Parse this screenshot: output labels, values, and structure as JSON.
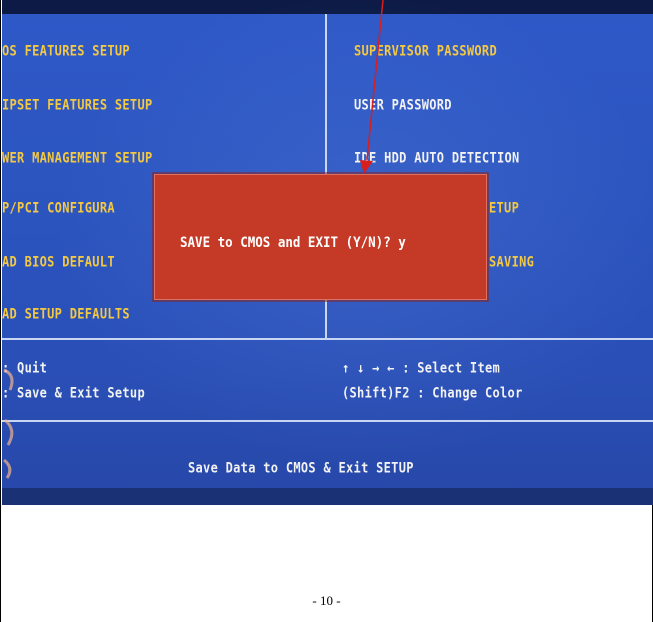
{
  "bios": {
    "left_menu": [
      "OS FEATURES SETUP",
      "IPSET FEATURES SETUP",
      "WER MANAGEMENT SETUP",
      "P/PCI CONFIGURA",
      "AD BIOS DEFAULT",
      "AD SETUP DEFAULTS"
    ],
    "right_menu": [
      "SUPERVISOR PASSWORD",
      "USER PASSWORD",
      "IDE HDD AUTO DETECTION",
      "ETUP",
      "SAVING"
    ],
    "dialog_prompt": "SAVE to CMOS and EXIT (Y/N)? y",
    "help_left": [
      ": Quit",
      ": Save & Exit Setup"
    ],
    "help_right": [
      "↑ ↓ → ←   : Select Item",
      "(Shift)F2 : Change Color"
    ],
    "status_line": "Save Data to CMOS & Exit SETUP"
  },
  "colors": {
    "bios_background": "#2c55c0",
    "menu_text": "#f3c842",
    "dialog_background": "#c53a26",
    "annotation_arrow": "#d81e1e"
  },
  "page_number": "- 10 -"
}
